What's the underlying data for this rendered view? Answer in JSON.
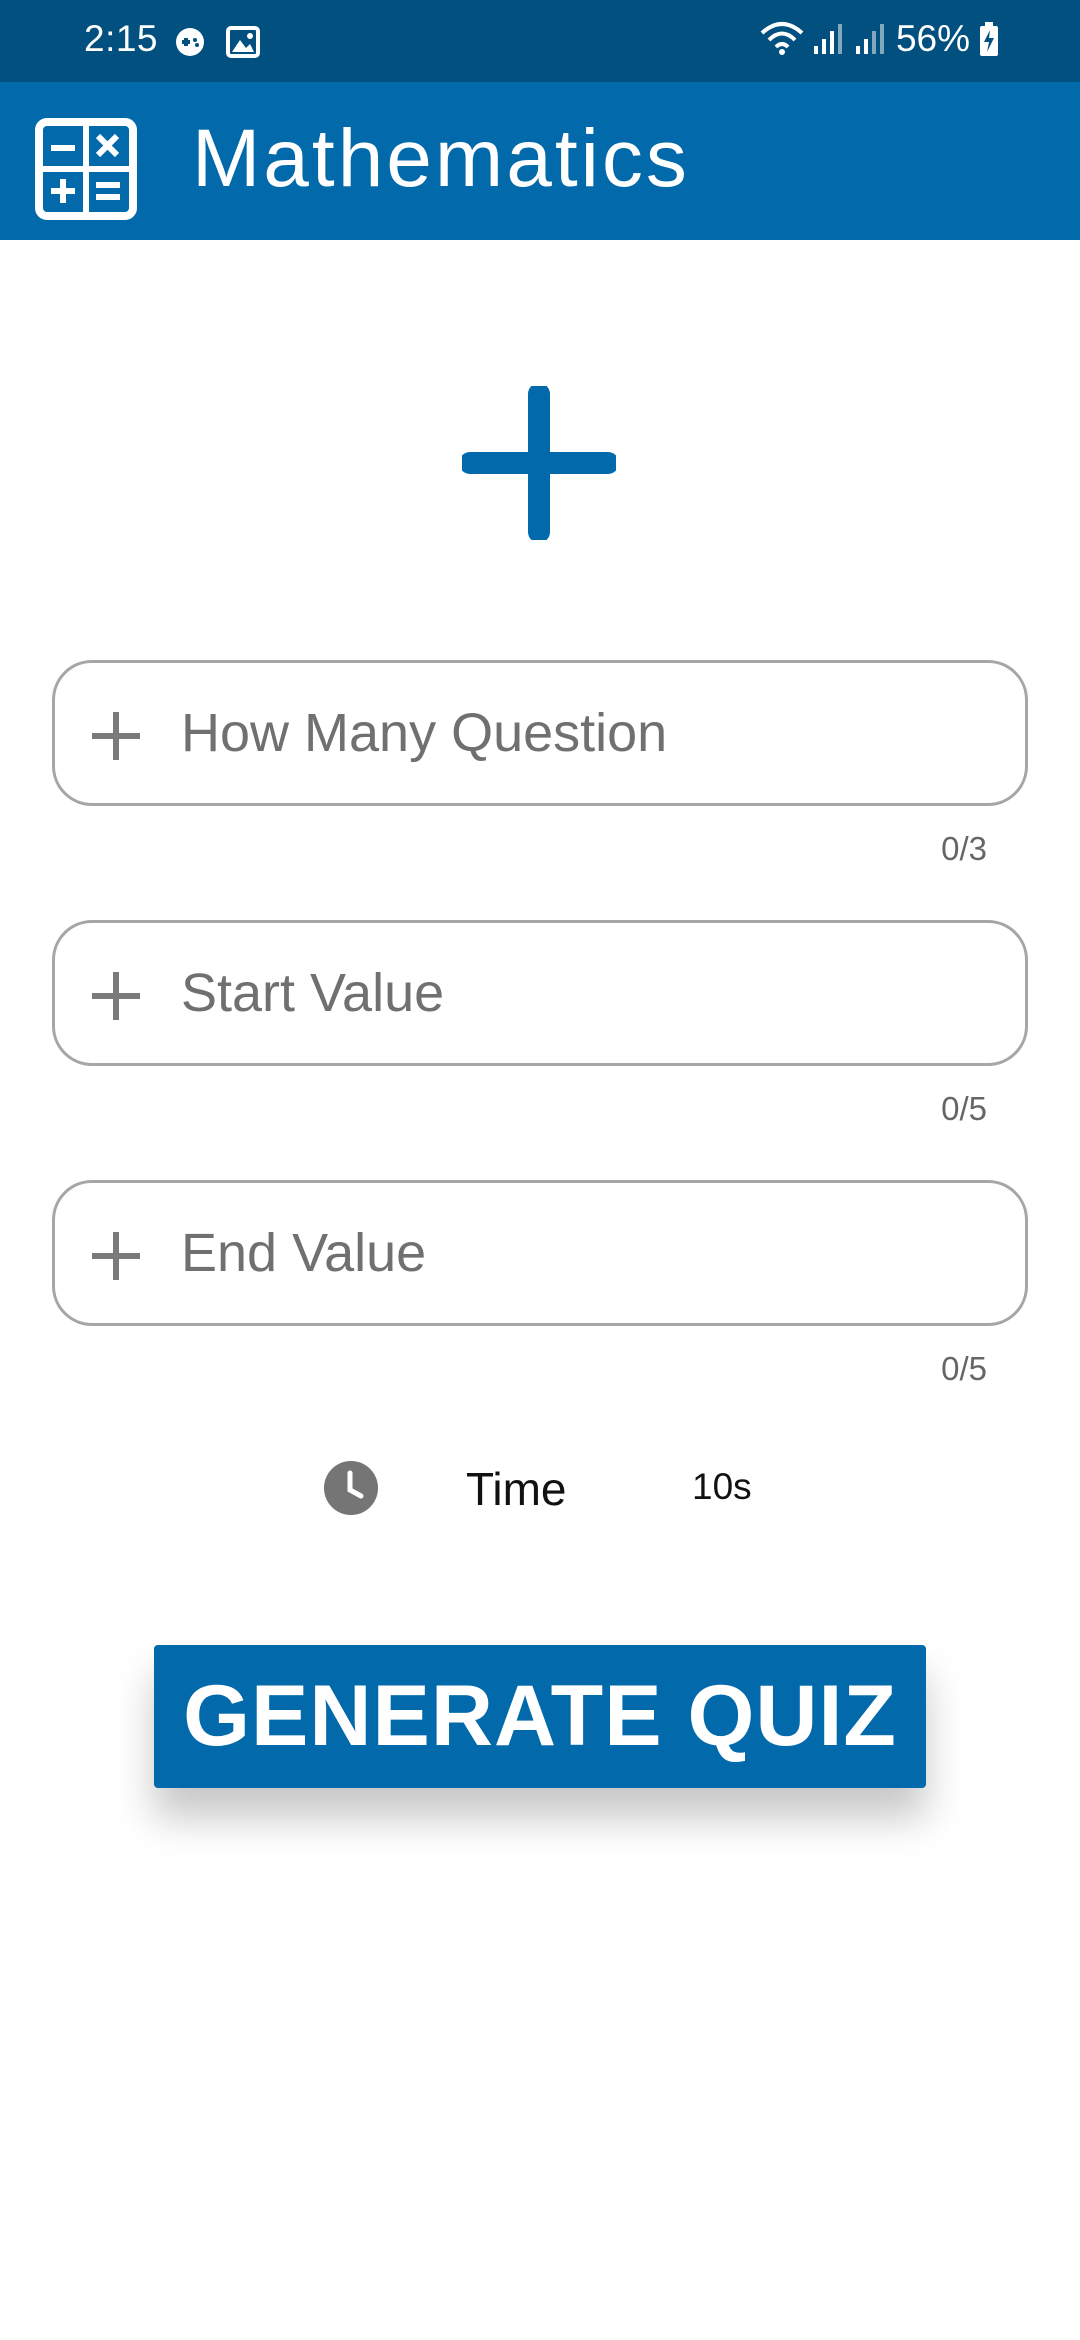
{
  "status_bar": {
    "time": "2:15",
    "battery": "56%",
    "icons": [
      "game-icon",
      "image-icon",
      "wifi-icon",
      "signal-icon",
      "signal-icon",
      "battery-charging-icon"
    ]
  },
  "app_bar": {
    "title": "Mathematics",
    "logo_icon": "calculator-icon",
    "color": "#0269ab"
  },
  "operator": {
    "icon": "plus-icon",
    "color": "#0269ab"
  },
  "fields": [
    {
      "placeholder": "How Many Question",
      "value": "",
      "counter": "0/3",
      "icon": "plus-icon"
    },
    {
      "placeholder": "Start Value",
      "value": "",
      "counter": "0/5",
      "icon": "plus-icon"
    },
    {
      "placeholder": "End Value",
      "value": "",
      "counter": "0/5",
      "icon": "plus-icon"
    }
  ],
  "time": {
    "icon": "clock-icon",
    "label": "Time",
    "value": "10s"
  },
  "generate_button": {
    "label": "GENERATE QUIZ",
    "color": "#0269ab"
  }
}
